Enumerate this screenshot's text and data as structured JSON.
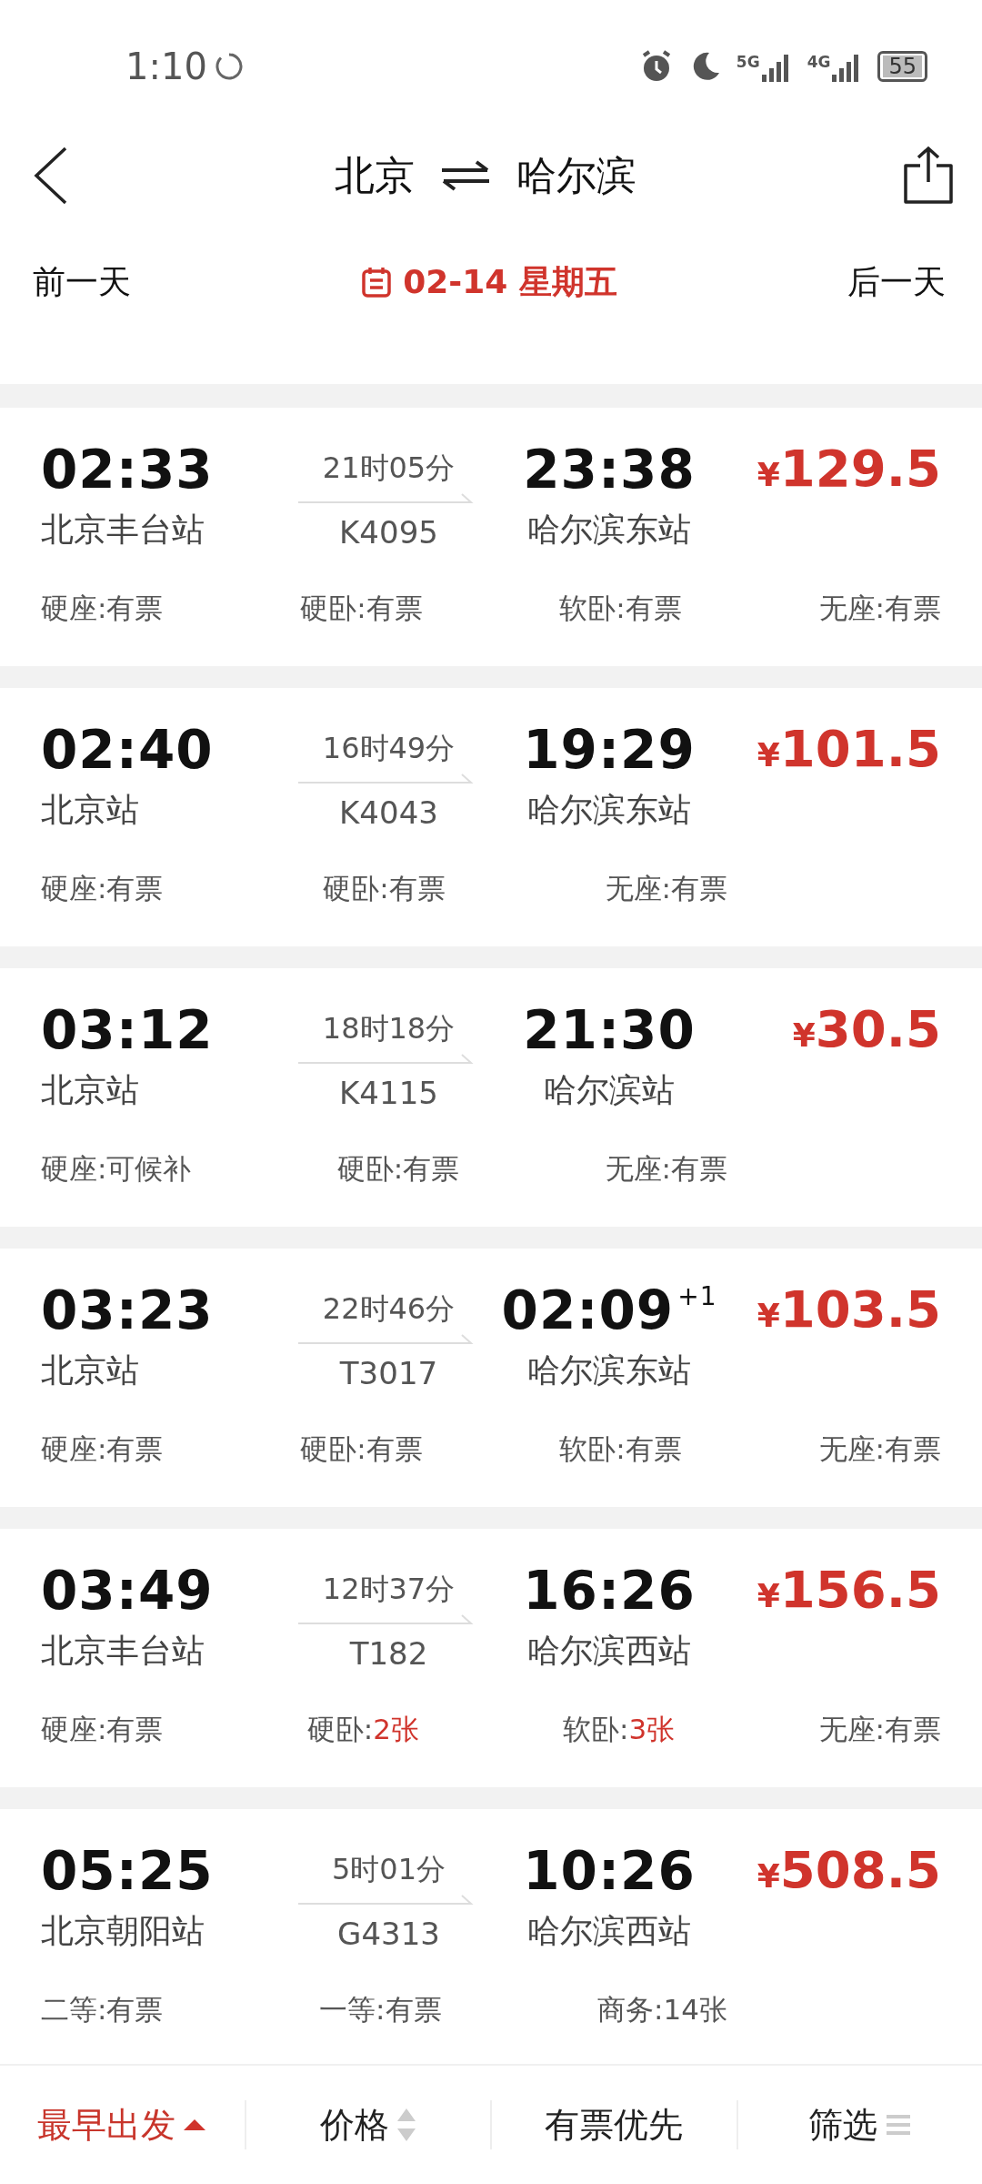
{
  "status_bar": {
    "time": "1:10",
    "networks": [
      "5G",
      "4G"
    ],
    "battery": "55"
  },
  "header": {
    "from": "北京",
    "to": "哈尔滨"
  },
  "date_bar": {
    "prev": "前一天",
    "date": "02-14 星期五",
    "next": "后一天"
  },
  "trains": [
    {
      "depart": "02:33",
      "from_station": "北京丰台站",
      "duration": "21时05分",
      "number": "K4095",
      "arrive": "23:38",
      "to_station": "哈尔滨东站",
      "price": "129.5",
      "currency": "¥",
      "seats": [
        {
          "label": "硬座:",
          "status": "有票",
          "highlight": false
        },
        {
          "label": "硬卧:",
          "status": "有票",
          "highlight": false
        },
        {
          "label": "软卧:",
          "status": "有票",
          "highlight": false
        },
        {
          "label": "无座:",
          "status": "有票",
          "highlight": false
        }
      ]
    },
    {
      "depart": "02:40",
      "from_station": "北京站",
      "duration": "16时49分",
      "number": "K4043",
      "arrive": "19:29",
      "to_station": "哈尔滨东站",
      "price": "101.5",
      "currency": "¥",
      "seats": [
        {
          "label": "硬座:",
          "status": "有票",
          "highlight": false
        },
        {
          "label": "硬卧:",
          "status": "有票",
          "highlight": false
        },
        {
          "label": "无座:",
          "status": "有票",
          "highlight": false
        }
      ]
    },
    {
      "depart": "03:12",
      "from_station": "北京站",
      "duration": "18时18分",
      "number": "K4115",
      "arrive": "21:30",
      "to_station": "哈尔滨站",
      "price": "30.5",
      "currency": "¥",
      "seats": [
        {
          "label": "硬座:",
          "status": "可候补",
          "highlight": false
        },
        {
          "label": "硬卧:",
          "status": "有票",
          "highlight": false
        },
        {
          "label": "无座:",
          "status": "有票",
          "highlight": false
        }
      ]
    },
    {
      "depart": "03:23",
      "from_station": "北京站",
      "duration": "22时46分",
      "number": "T3017",
      "arrive": "02:09",
      "next_day": "+1",
      "to_station": "哈尔滨东站",
      "price": "103.5",
      "currency": "¥",
      "seats": [
        {
          "label": "硬座:",
          "status": "有票",
          "highlight": false
        },
        {
          "label": "硬卧:",
          "status": "有票",
          "highlight": false
        },
        {
          "label": "软卧:",
          "status": "有票",
          "highlight": false
        },
        {
          "label": "无座:",
          "status": "有票",
          "highlight": false
        }
      ]
    },
    {
      "depart": "03:49",
      "from_station": "北京丰台站",
      "duration": "12时37分",
      "number": "T182",
      "arrive": "16:26",
      "to_station": "哈尔滨西站",
      "price": "156.5",
      "currency": "¥",
      "seats": [
        {
          "label": "硬座:",
          "status": "有票",
          "highlight": false
        },
        {
          "label": "硬卧:",
          "status": "2张",
          "highlight": true
        },
        {
          "label": "软卧:",
          "status": "3张",
          "highlight": true
        },
        {
          "label": "无座:",
          "status": "有票",
          "highlight": false
        }
      ]
    },
    {
      "depart": "05:25",
      "from_station": "北京朝阳站",
      "duration": "5时01分",
      "number": "G4313",
      "arrive": "10:26",
      "to_station": "哈尔滨西站",
      "price": "508.5",
      "currency": "¥",
      "seats": [
        {
          "label": "二等:",
          "status": "有票",
          "highlight": false
        },
        {
          "label": "一等:",
          "status": "有票",
          "highlight": false
        },
        {
          "label": "商务:",
          "status": "14张",
          "highlight": false
        }
      ]
    }
  ],
  "sort_bar": [
    {
      "label": "最早出发",
      "kind": "sort",
      "selected": true
    },
    {
      "label": "价格",
      "kind": "sort",
      "selected": false
    },
    {
      "label": "有票优先",
      "kind": "toggle",
      "selected": false
    },
    {
      "label": "筛选",
      "kind": "filter",
      "selected": false
    }
  ]
}
